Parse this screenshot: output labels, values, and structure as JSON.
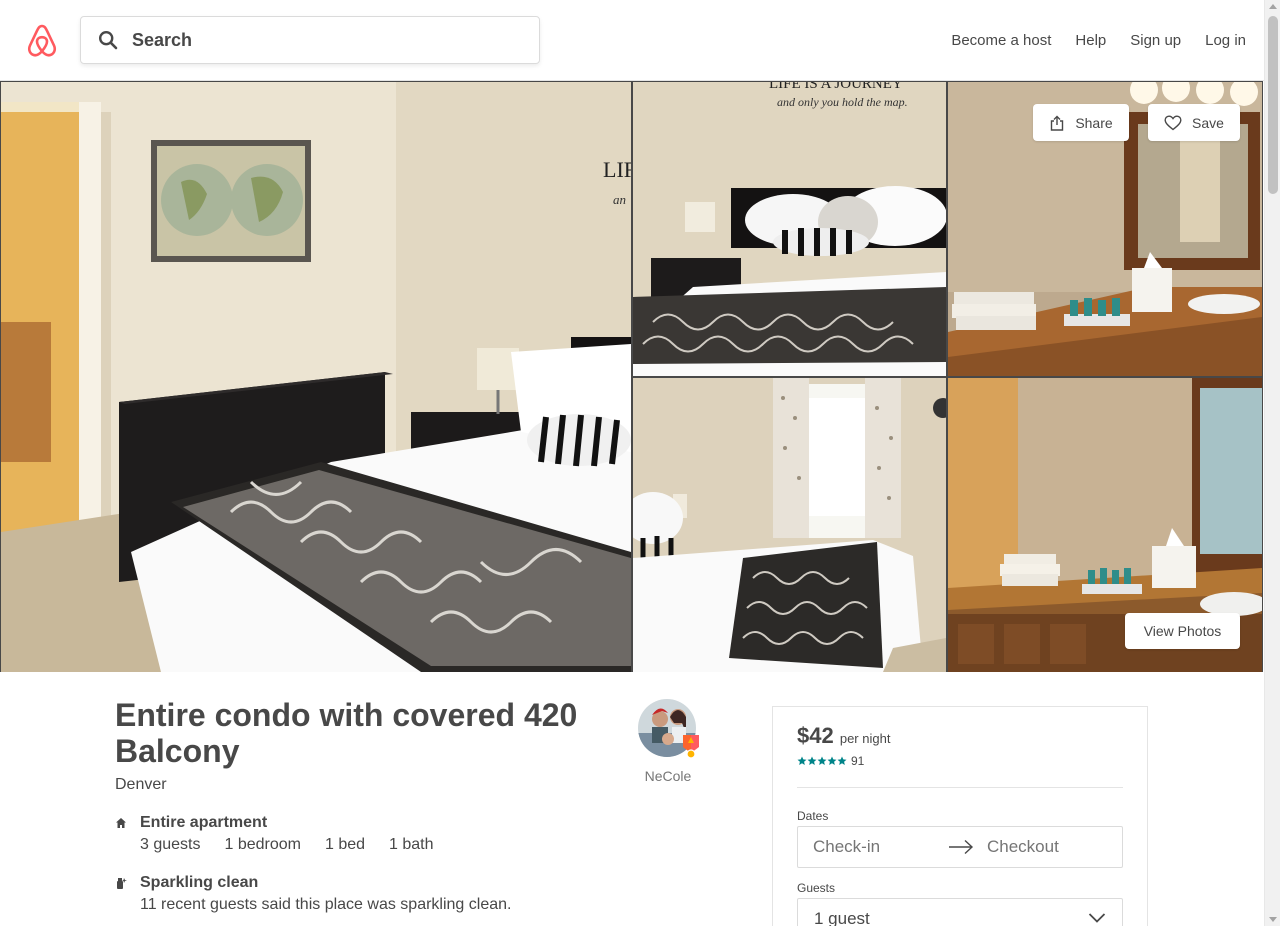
{
  "header": {
    "search": {
      "placeholder": "Search"
    },
    "nav": [
      "Become a host",
      "Help",
      "Sign up",
      "Log in"
    ]
  },
  "photos": {
    "share_label": "Share",
    "save_label": "Save",
    "view_label": "View Photos",
    "wall_text": "LIFE IS A JOURNEY",
    "wall_text_sub": "and only you hold the map."
  },
  "listing": {
    "title": "Entire condo with covered 420 Balcony",
    "location": "Denver",
    "host_name": "NeCole",
    "features": [
      {
        "icon": "home-icon",
        "title": "Entire apartment",
        "stats": [
          "3 guests",
          "1 bedroom",
          "1 bed",
          "1 bath"
        ]
      },
      {
        "icon": "sparkle-icon",
        "title": "Sparkling clean",
        "description": "11 recent guests said this place was sparkling clean."
      }
    ]
  },
  "booking": {
    "price": "$42",
    "per_night": "per night",
    "rating_stars": 5,
    "review_count": "91",
    "dates_label": "Dates",
    "checkin_placeholder": "Check-in",
    "checkout_placeholder": "Checkout",
    "guests_label": "Guests",
    "guests_value": "1 guest"
  },
  "colors": {
    "brand": "#FF5A5F",
    "text": "#484848",
    "star": "#008489",
    "border": "#e4e4e4"
  }
}
